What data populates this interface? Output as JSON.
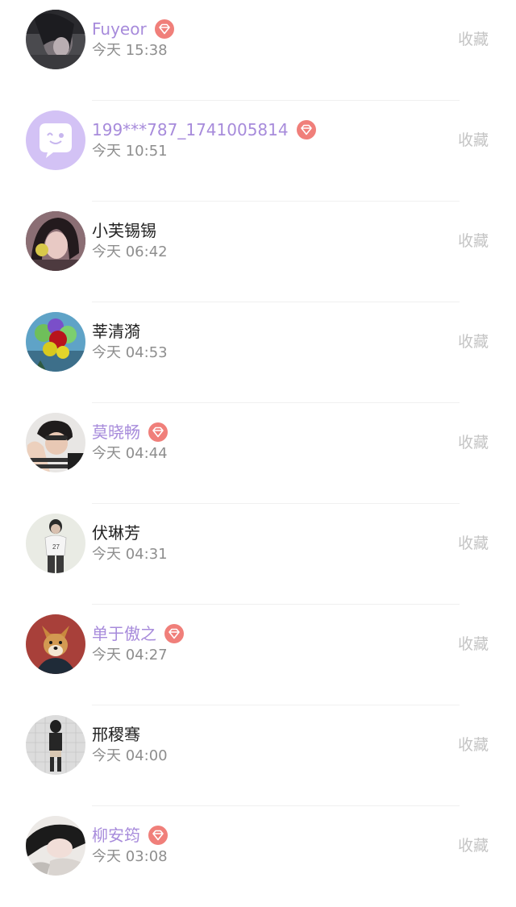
{
  "colors": {
    "vip_name": "#a78bdb",
    "vip_badge": "#f07f7a",
    "normal_name": "#222222",
    "time_text": "#8e8e8e",
    "action_text": "#c4c4c4"
  },
  "users": [
    {
      "name": "Fuyeor",
      "time": "今天 15:38",
      "action": "收藏",
      "vip": true,
      "avatar_icon": "dark-hair-portrait-icon"
    },
    {
      "name": "199***787_1741005814",
      "time": "今天 10:51",
      "action": "收藏",
      "vip": true,
      "avatar_icon": "chat-bubble-icon"
    },
    {
      "name": "小芙锡锡",
      "time": "今天 06:42",
      "action": "收藏",
      "vip": false,
      "avatar_icon": "girl-portrait-icon"
    },
    {
      "name": "莘清漪",
      "time": "今天 04:53",
      "action": "收藏",
      "vip": false,
      "avatar_icon": "balloons-icon"
    },
    {
      "name": "莫晓畅",
      "time": "今天 04:44",
      "action": "收藏",
      "vip": true,
      "avatar_icon": "waving-hand-portrait-icon"
    },
    {
      "name": "伏琳芳",
      "time": "今天 04:31",
      "action": "收藏",
      "vip": false,
      "avatar_icon": "standing-person-icon"
    },
    {
      "name": "单于傲之",
      "time": "今天 04:27",
      "action": "收藏",
      "vip": true,
      "avatar_icon": "shiba-dog-icon"
    },
    {
      "name": "邢稷骞",
      "time": "今天 04:00",
      "action": "收藏",
      "vip": false,
      "avatar_icon": "full-body-person-icon"
    },
    {
      "name": "柳安筠",
      "time": "今天 03:08",
      "action": "收藏",
      "vip": true,
      "avatar_icon": "lying-girl-icon"
    }
  ]
}
